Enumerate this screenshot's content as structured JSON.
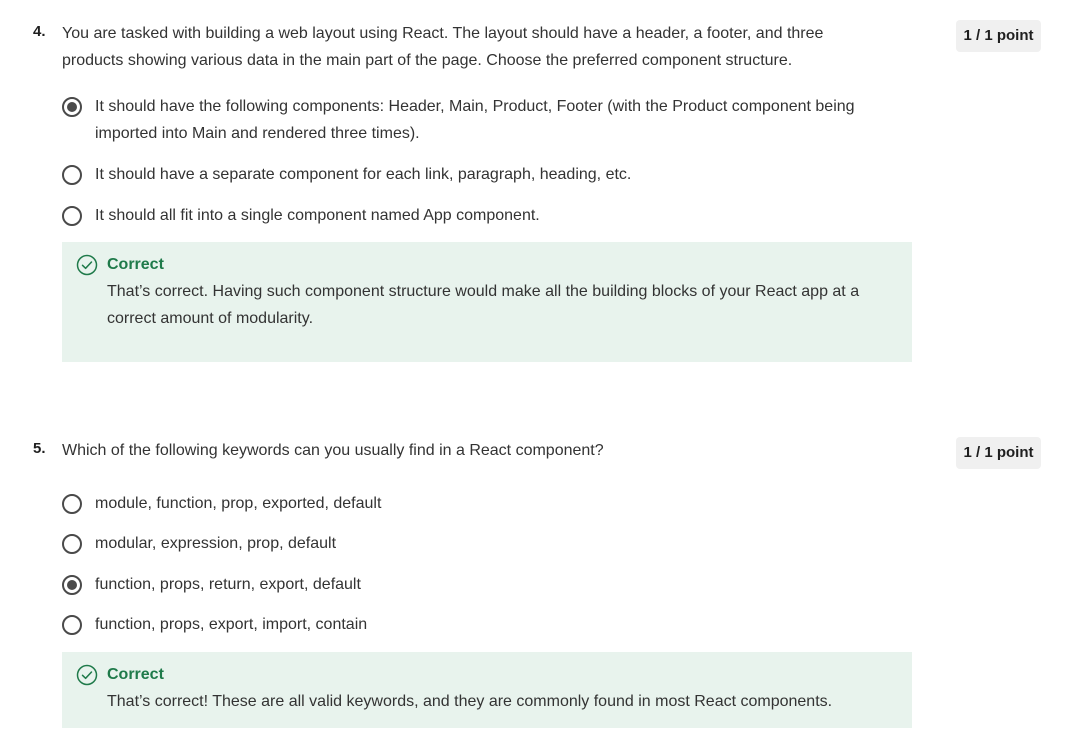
{
  "questions": [
    {
      "number": "4.",
      "text": "You are tasked with building a web layout using React. The layout should have a header, a footer, and three products showing various data in the main part of the page. Choose the preferred component structure.",
      "points": "1 / 1 point",
      "options": [
        {
          "label": "It should have the following components: Header, Main, Product, Footer (with the Product component being imported into Main and rendered three times).",
          "selected": true
        },
        {
          "label": "It should have a separate component for each link, paragraph, heading, etc.",
          "selected": false
        },
        {
          "label": "It should all fit into a single component named App component.",
          "selected": false
        }
      ],
      "feedback": {
        "title": "Correct",
        "text": "That’s correct. Having such component structure would make all the building blocks of your React app at a correct amount of modularity."
      }
    },
    {
      "number": "5.",
      "text": "Which of the following keywords can you usually find in a React component?",
      "points": "1 / 1 point",
      "options": [
        {
          "label": "module, function, prop, exported, default",
          "selected": false
        },
        {
          "label": "modular, expression, prop, default",
          "selected": false
        },
        {
          "label": "function, props, return, export, default",
          "selected": true
        },
        {
          "label": "function, props, export, import, contain",
          "selected": false
        }
      ],
      "feedback": {
        "title": "Correct",
        "text": "That’s correct! These are all valid keywords, and they are commonly found in most React components."
      }
    }
  ],
  "icons": {
    "feedback_icon": "check-circle-icon",
    "option_icon": "radio-button-icon"
  },
  "colors": {
    "correct_green": "#1f7a4a",
    "feedback_bg": "#e8f3ed",
    "badge_bg": "#f0f0f0",
    "radio": "#4a4a4a"
  }
}
